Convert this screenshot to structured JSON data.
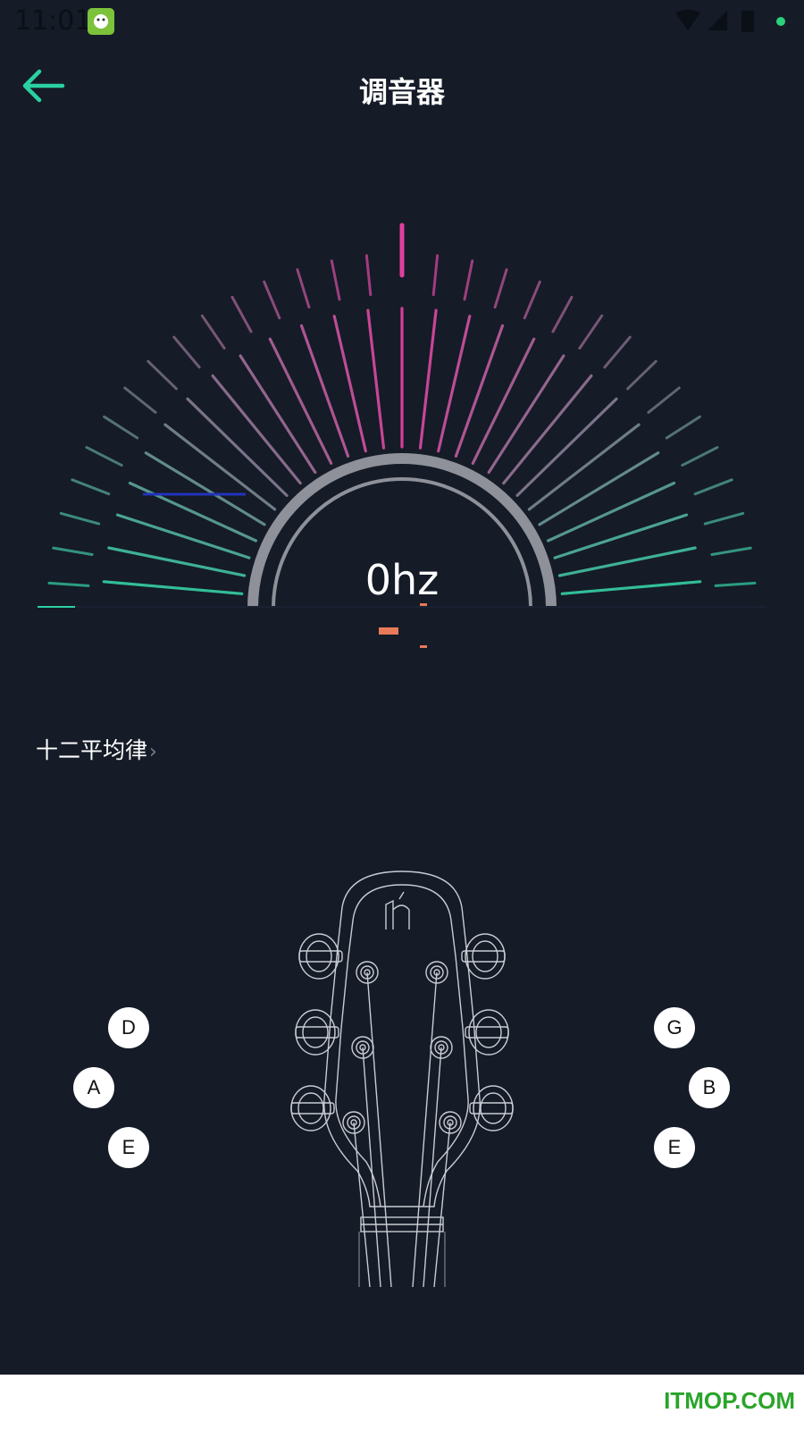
{
  "status_bar": {
    "time": "11:01"
  },
  "header": {
    "title": "调音器",
    "back_icon": "arrow-left-icon"
  },
  "tuner": {
    "frequency": "0hz"
  },
  "temperament": {
    "label": "十二平均律"
  },
  "strings": {
    "left": [
      "D",
      "A",
      "E"
    ],
    "right": [
      "G",
      "B",
      "E"
    ]
  },
  "footer": {
    "watermark": "ITMOP.COM"
  },
  "colors": {
    "accent": "#2ad1a1",
    "magenta": "#e040a0",
    "background": "#151b27",
    "indicator": "#e87a5a"
  }
}
